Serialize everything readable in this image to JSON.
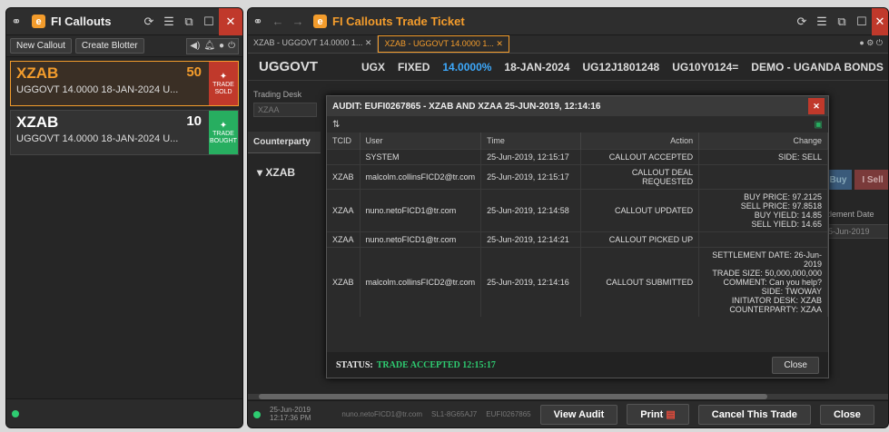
{
  "left_window": {
    "title": "FI Callouts",
    "toolbar": {
      "new_callout": "New Callout",
      "create_blotter": "Create Blotter"
    },
    "callouts": [
      {
        "code": "XZAB",
        "quantity": "50",
        "desc": "UGGOVT 14.0000 18-JAN-2024 U...",
        "badge_line1": "TRADE",
        "badge_line2": "SOLD",
        "badge_color": "#c0392b"
      },
      {
        "code": "XZAB",
        "quantity": "10",
        "desc": "UGGOVT 14.0000 18-JAN-2024 U...",
        "badge_line1": "TRADE",
        "badge_line2": "BOUGHT",
        "badge_color": "#27ae60"
      }
    ]
  },
  "right_window": {
    "title": "FI Callouts Trade Ticket",
    "tabs": [
      "XZAB - UGGOVT 14.0000 1...",
      "XZAB - UGGOVT 14.0000 1..."
    ],
    "bond": {
      "name": "UGGOVT",
      "currency": "UGX",
      "type": "FIXED",
      "coupon": "14.0000%",
      "maturity": "18-JAN-2024",
      "ric1": "UG12J1801248",
      "ric2": "UG10Y0124=",
      "desk": "DEMO - UGANDA BONDS"
    },
    "trading_desk_label": "Trading Desk",
    "trading_desk_value": "XZAA",
    "counterparty_label": "Counterparty",
    "counterparty_value": "XZAB",
    "buy_label": "Buy",
    "sell_label": "I Sell",
    "settlement_label": "ttlement Date",
    "settlement_value": "5-Jun-2019",
    "footer": {
      "date": "25-Jun-2019",
      "time": "12:17:36 PM",
      "user": "nuno.netoFICD1@tr.com",
      "ref": "SL1-8G65AJ7",
      "id": "EUFI0267865",
      "view_audit": "View Audit",
      "print": "Print",
      "cancel_trade": "Cancel This Trade",
      "close": "Close"
    }
  },
  "audit_modal": {
    "title": "AUDIT: EUFI0267865 - XZAB AND XZAA 25-JUN-2019, 12:14:16",
    "columns": [
      "TCID",
      "User",
      "Time",
      "Action",
      "Change"
    ],
    "rows": [
      {
        "tcid": "",
        "user": "SYSTEM",
        "time": "25-Jun-2019, 12:15:17",
        "action": "CALLOUT ACCEPTED",
        "change": [
          "SIDE: SELL"
        ]
      },
      {
        "tcid": "XZAB",
        "user": "malcolm.collinsFICD2@tr.com",
        "time": "25-Jun-2019, 12:15:17",
        "action": "CALLOUT DEAL REQUESTED",
        "change": []
      },
      {
        "tcid": "XZAA",
        "user": "nuno.netoFICD1@tr.com",
        "time": "25-Jun-2019, 12:14:58",
        "action": "CALLOUT UPDATED",
        "change": [
          "BUY PRICE: 97.2125",
          "SELL PRICE: 97.8518",
          "BUY YIELD: 14.85",
          "SELL YIELD: 14.65"
        ]
      },
      {
        "tcid": "XZAA",
        "user": "nuno.netoFICD1@tr.com",
        "time": "25-Jun-2019, 12:14:21",
        "action": "CALLOUT PICKED UP",
        "change": []
      },
      {
        "tcid": "XZAB",
        "user": "malcolm.collinsFICD2@tr.com",
        "time": "25-Jun-2019, 12:14:16",
        "action": "CALLOUT SUBMITTED",
        "change": [
          "SETTLEMENT DATE: 26-Jun-2019",
          "TRADE SIZE: 50,000,000,000",
          "COMMENT: Can you help?",
          "SIDE: TWOWAY",
          "INITIATOR DESK: XZAB",
          "COUNTERPARTY: XZAA"
        ]
      }
    ],
    "status_label": "STATUS:",
    "status_value": "TRADE ACCEPTED 12:15:17",
    "close_label": "Close"
  }
}
